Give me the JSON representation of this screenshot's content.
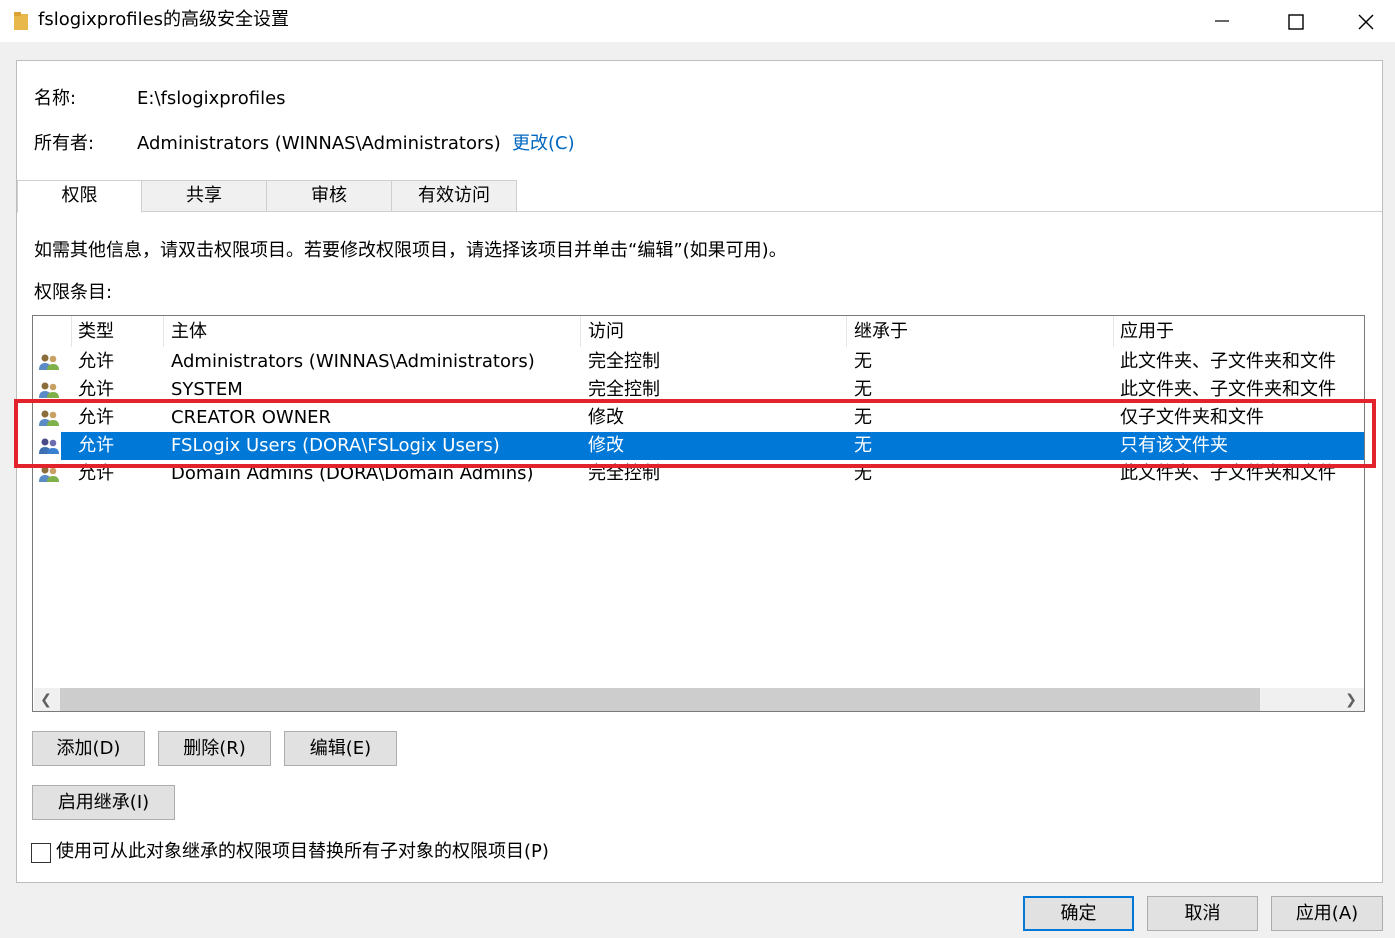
{
  "window": {
    "title": "fslogixprofiles的高级安全设置",
    "icon": "folder-icon"
  },
  "info": {
    "name_label": "名称:",
    "name_value": "E:\\fslogixprofiles",
    "owner_label": "所有者:",
    "owner_value": "Administrators (WINNAS\\Administrators)",
    "change_link": "更改(C)"
  },
  "tabs": [
    {
      "label": "权限",
      "active": true
    },
    {
      "label": "共享",
      "active": false
    },
    {
      "label": "审核",
      "active": false
    },
    {
      "label": "有效访问",
      "active": false
    }
  ],
  "instructions": "如需其他信息，请双击权限项目。若要修改权限项目，请选择该项目并单击“编辑”(如果可用)。",
  "entries_label": "权限条目:",
  "table": {
    "headers": [
      "类型",
      "主体",
      "访问",
      "继承于",
      "应用于"
    ],
    "rows": [
      {
        "type": "允许",
        "principal": "Administrators (WINNAS\\Administrators)",
        "access": "完全控制",
        "inherited": "无",
        "applies": "此文件夹、子文件夹和文件",
        "selected": false
      },
      {
        "type": "允许",
        "principal": "SYSTEM",
        "access": "完全控制",
        "inherited": "无",
        "applies": "此文件夹、子文件夹和文件",
        "selected": false
      },
      {
        "type": "允许",
        "principal": "CREATOR OWNER",
        "access": "修改",
        "inherited": "无",
        "applies": "仅子文件夹和文件",
        "selected": false
      },
      {
        "type": "允许",
        "principal": "FSLogix Users (DORA\\FSLogix Users)",
        "access": "修改",
        "inherited": "无",
        "applies": "只有该文件夹",
        "selected": true
      },
      {
        "type": "允许",
        "principal": "Domain Admins (DORA\\Domain Admins)",
        "access": "完全控制",
        "inherited": "无",
        "applies": "此文件夹、子文件夹和文件",
        "selected": false
      }
    ]
  },
  "buttons": {
    "add": "添加(D)",
    "remove": "删除(R)",
    "edit": "编辑(E)",
    "enable_inheritance": "启用继承(I)"
  },
  "checkbox": {
    "label": "使用可从此对象继承的权限项目替换所有子对象的权限项目(P)",
    "checked": false
  },
  "dialog_buttons": {
    "ok": "确定",
    "cancel": "取消",
    "apply": "应用(A)"
  },
  "colors": {
    "selection": "#0078d7",
    "link": "#0067c0",
    "highlight_box": "#e3232c"
  }
}
